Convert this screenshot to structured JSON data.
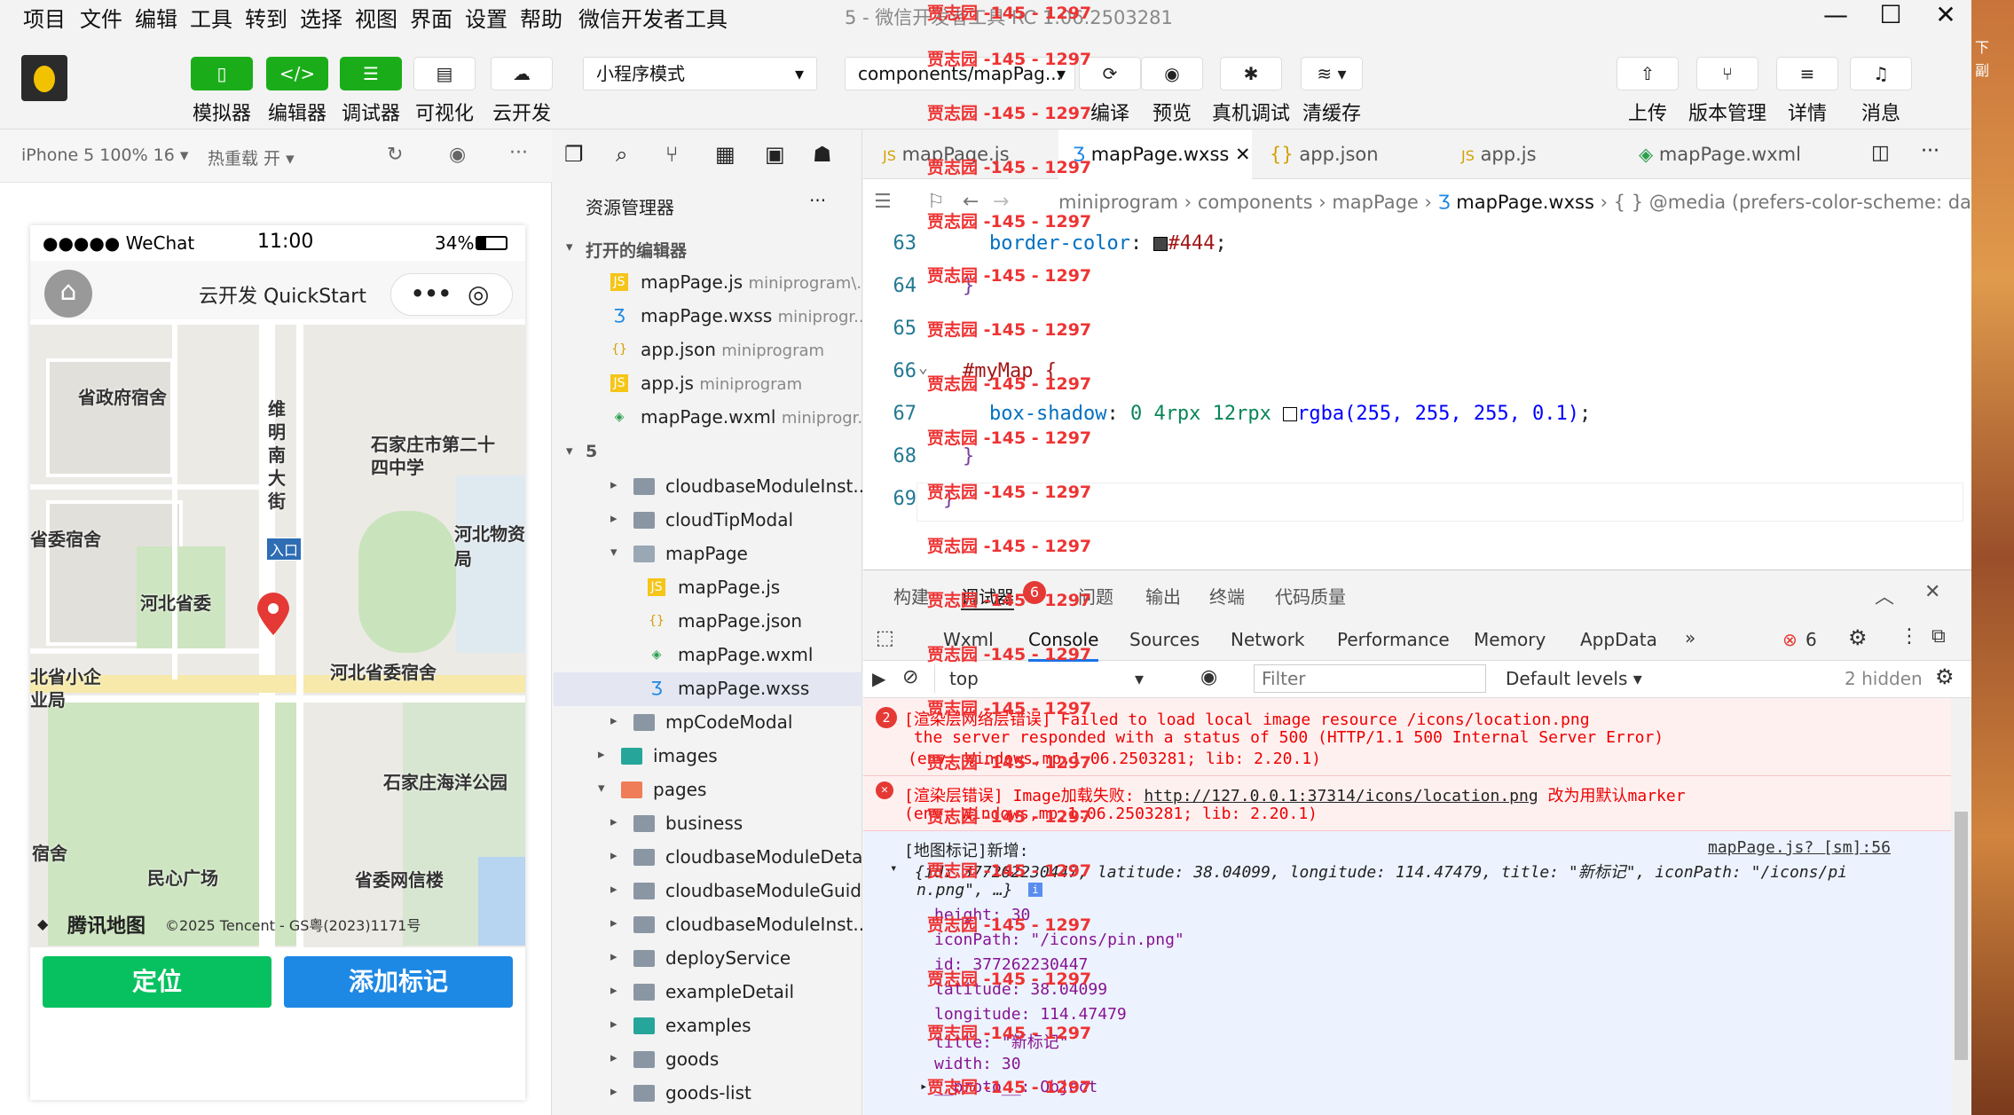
{
  "menu": [
    "项目",
    "文件",
    "编辑",
    "工具",
    "转到",
    "选择",
    "视图",
    "界面",
    "设置",
    "帮助",
    "微信开发者工具"
  ],
  "window_title": "5 - 微信开发者工具 RC 1.06.2503281",
  "toolbar": {
    "simulator_label": "模拟器",
    "editor_label": "编辑器",
    "debugger_label": "调试器",
    "visual_label": "可视化",
    "cloud_label": "云开发",
    "mode_select": "小程序模式",
    "page_select": "components/mapPag...",
    "compile_label": "编译",
    "preview_label": "预览",
    "real_debug_label": "真机调试",
    "clear_cache_label": "清缓存",
    "upload_label": "上传",
    "version_label": "版本管理",
    "details_label": "详情",
    "messages_label": "消息"
  },
  "simulator": {
    "device": "iPhone 5 100% 16 ▾",
    "hotreload": "热重载 开 ▾",
    "carrier": "●●●●● WeChat",
    "time": "11:00",
    "battery": "34%",
    "nav_title": "云开发 QuickStart",
    "map_labels": [
      "省政府宿舍",
      "维明南大街",
      "石家庄市第二十四中学",
      "省委宿舍",
      "河北物资局",
      "入口",
      "河北省委",
      "河北省委宿舍",
      "北省小企业局",
      "石家庄海洋公园",
      "宿舍",
      "民心广场",
      "省委网信楼"
    ],
    "map_brand": "腾讯地图",
    "map_copyright": "©2025 Tencent - GS粤(2023)1171号",
    "btn_locate": "定位",
    "btn_add_marker": "添加标记"
  },
  "explorer": {
    "title": "资源管理器",
    "open_editors": "打开的编辑器",
    "open_files": [
      {
        "name": "mapPage.js",
        "path": "miniprogram\\...",
        "icon": "js"
      },
      {
        "name": "mapPage.wxss",
        "path": "miniprogr...",
        "icon": "wxss"
      },
      {
        "name": "app.json",
        "path": "miniprogram",
        "icon": "json"
      },
      {
        "name": "app.js",
        "path": "miniprogram",
        "icon": "js"
      },
      {
        "name": "mapPage.wxml",
        "path": "miniprogr...",
        "icon": "wxml"
      }
    ],
    "project": "5",
    "tree": [
      "cloudbaseModuleInst...",
      "cloudTipModal",
      "mapPage",
      "mapPage.js",
      "mapPage.json",
      "mapPage.wxml",
      "mapPage.wxss",
      "mpCodeModal",
      "images",
      "pages",
      "business",
      "cloudbaseModuleDetail",
      "cloudbaseModuleGuide",
      "cloudbaseModuleInst...",
      "deployService",
      "exampleDetail",
      "examples",
      "goods",
      "goods-list"
    ]
  },
  "editor": {
    "tabs": [
      "mapPage.js",
      "mapPage.wxss",
      "app.json",
      "app.js",
      "mapPage.wxml"
    ],
    "breadcrumb": [
      "miniprogram",
      "components",
      "mapPage",
      "mapPage.wxss",
      "{ }",
      "@media (prefers-color-scheme: dark)"
    ],
    "line_numbers": [
      "63",
      "64",
      "65",
      "66",
      "67",
      "68",
      "69"
    ],
    "line63_prop": "border-color",
    "line63_val": "#444",
    "line66_sel": "#myMap {",
    "line67_prop": "box-shadow",
    "line67_val": "0 4rpx 12rpx",
    "line67_fn": "rgba(255, 255, 255, 0.1)",
    "brace_close": "}"
  },
  "devtools": {
    "top_tabs": [
      "构建",
      "调试器",
      "问题",
      "输出",
      "终端",
      "代码质量"
    ],
    "debugger_badge": "6",
    "panel_tabs": [
      "Wxml",
      "Console",
      "Sources",
      "Network",
      "Performance",
      "Memory",
      "AppData"
    ],
    "error_count": "6",
    "context": "top",
    "filter_placeholder": "Filter",
    "levels": "Default levels ▾",
    "hidden": "2 hidden",
    "log1_count": "2",
    "log1_l1": "[渲染层网络层错误] Failed to load local image resource /icons/location.png",
    "log1_l2": " the server responded with a status of 500 (HTTP/1.1 500 Internal Server Error)",
    "log1_l3": "(env: Windows,mp,1.06.2503281; lib: 2.20.1)",
    "log2_prefix": "[渲染层错误] Image加载失败: ",
    "log2_link": "http://127.0.0.1:37314/icons/location.png",
    "log2_suffix": " 改为用默认marker",
    "log2_l2": "(env: Windows,mp,1.06.2503281; lib: 2.20.1)",
    "log3_title": "[地图标记]新增:",
    "log3_src": "mapPage.js? [sm]:56",
    "log3_obj1": "{id: 377262230447, latitude: 38.04099, longitude: 114.47479, title: \"新标记\", iconPath: \"/icons/pi",
    "log3_obj2": "n.png\", …}",
    "props": [
      "height: 30",
      "iconPath: \"/icons/pin.png\"",
      "id: 377262230447",
      "latitude: 38.04099",
      "longitude: 114.47479",
      "title: \"新标记\"",
      "width: 30",
      "__proto__: Object"
    ]
  },
  "watermark": "贾志园 -145 - 1297",
  "desktop_chars": [
    "下",
    "副"
  ]
}
